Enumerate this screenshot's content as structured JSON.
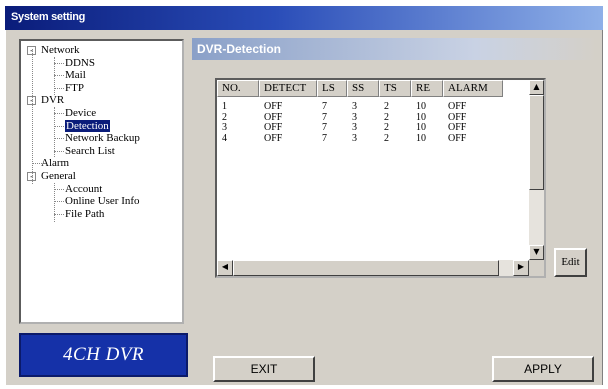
{
  "window": {
    "title": "System setting"
  },
  "tree": {
    "items": [
      {
        "label": "Network",
        "level": 0,
        "toggle": "-"
      },
      {
        "label": "DDNS",
        "level": 1
      },
      {
        "label": "Mail",
        "level": 1
      },
      {
        "label": "FTP",
        "level": 1
      },
      {
        "label": "DVR",
        "level": 0,
        "toggle": "-"
      },
      {
        "label": "Device",
        "level": 1
      },
      {
        "label": "Detection",
        "level": 1,
        "selected": true
      },
      {
        "label": "Network Backup",
        "level": 1
      },
      {
        "label": "Search List",
        "level": 1
      },
      {
        "label": "Alarm",
        "level": 0
      },
      {
        "label": "General",
        "level": 0,
        "toggle": "-"
      },
      {
        "label": "Account",
        "level": 1
      },
      {
        "label": "Online User Info",
        "level": 1
      },
      {
        "label": "File Path",
        "level": 1
      }
    ]
  },
  "logo": {
    "text": "4CH DVR"
  },
  "section": {
    "title": "DVR-Detection"
  },
  "table": {
    "columns": [
      "NO.",
      "DETECT",
      "LS",
      "SS",
      "TS",
      "RE",
      "ALARM"
    ],
    "rows": [
      [
        "1",
        "OFF",
        "7",
        "3",
        "2",
        "10",
        "OFF"
      ],
      [
        "2",
        "OFF",
        "7",
        "3",
        "2",
        "10",
        "OFF"
      ],
      [
        "3",
        "OFF",
        "7",
        "3",
        "2",
        "10",
        "OFF"
      ],
      [
        "4",
        "OFF",
        "7",
        "3",
        "2",
        "10",
        "OFF"
      ]
    ]
  },
  "buttons": {
    "edit": "Edit",
    "exit": "EXIT",
    "apply": "APPLY"
  },
  "icons": {
    "scroll_up": "triangle-up",
    "scroll_down": "triangle-down",
    "scroll_left": "triangle-left",
    "scroll_right": "triangle-right"
  }
}
